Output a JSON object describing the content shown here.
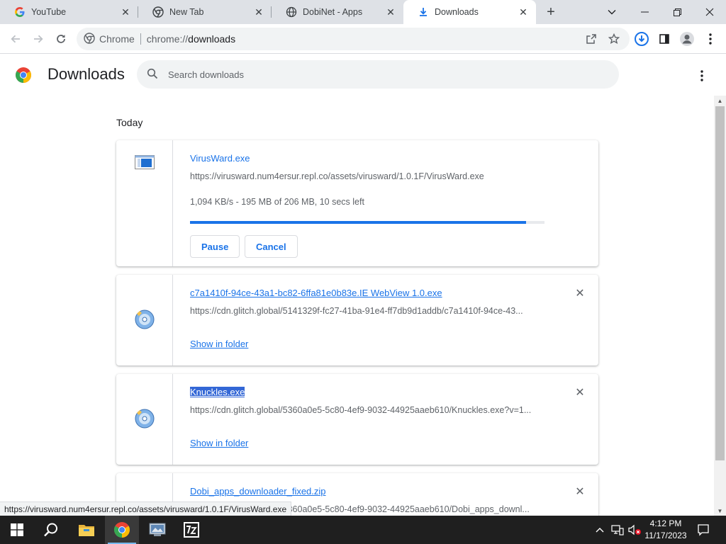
{
  "browser": {
    "tabs": [
      {
        "title": "YouTube",
        "favicon": "google-g-icon"
      },
      {
        "title": "New Tab",
        "favicon": "chrome-icon"
      },
      {
        "title": "DobiNet - Apps",
        "favicon": "globe-icon"
      },
      {
        "title": "Downloads",
        "favicon": "download-icon",
        "active": true
      }
    ],
    "omnibox": {
      "site_label": "Chrome",
      "url_scheme": "chrome://",
      "url_host": "downloads"
    }
  },
  "page": {
    "title": "Downloads",
    "search_placeholder": "Search downloads",
    "section_date": "Today"
  },
  "downloads": [
    {
      "filename": "VirusWard.exe",
      "url": "https://virusward.num4ersur.repl.co/assets/virusward/1.0.1F/VirusWard.exe",
      "status": "1,094 KB/s - 195 MB of 206 MB, 10 secs left",
      "progress_percent": 94.7,
      "pause_label": "Pause",
      "cancel_label": "Cancel"
    },
    {
      "filename": "c7a1410f-94ce-43a1-bc82-6ffa81e0b83e.IE WebView 1.0.exe",
      "url": "https://cdn.glitch.global/5141329f-fc27-41ba-91e4-ff7db9d1addb/c7a1410f-94ce-43...",
      "show_label": "Show in folder"
    },
    {
      "filename": "Knuckles.exe",
      "url": "https://cdn.glitch.global/5360a0e5-5c80-4ef9-9032-44925aaeb610/Knuckles.exe?v=1...",
      "show_label": "Show in folder"
    },
    {
      "filename": "Dobi_apps_downloader_fixed.zip",
      "url": "https://cdn.glitch.global/5360a0e5-5c80-4ef9-9032-44925aaeb610/Dobi_apps_downl..."
    }
  ],
  "status_bubble": "https://virusward.num4ersur.repl.co/assets/virusward/1.0.1F/VirusWard.exe",
  "taskbar": {
    "time": "4:12 PM",
    "date": "11/17/2023"
  },
  "colors": {
    "accent": "#1a73e8",
    "tab_strip": "#dee1e6",
    "taskbar": "#1f1f1f"
  }
}
